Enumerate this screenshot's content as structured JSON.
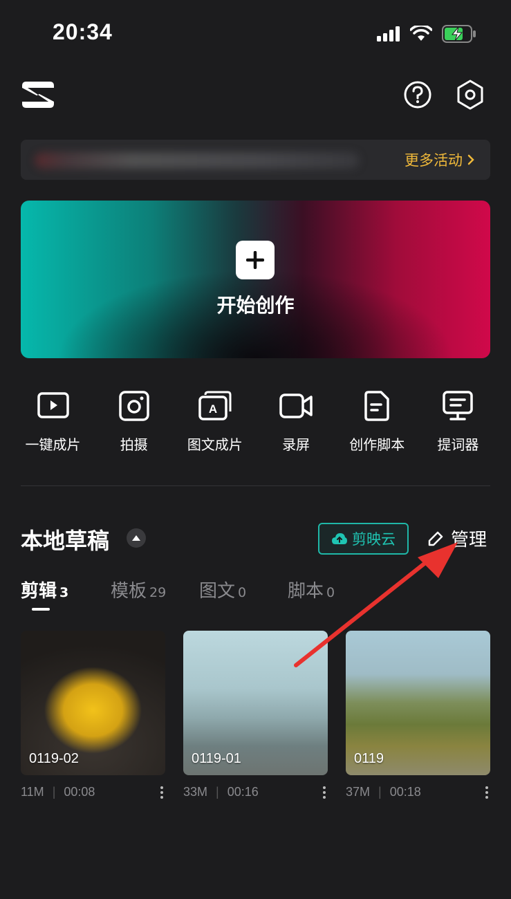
{
  "status_bar": {
    "time": "20:34"
  },
  "banner": {
    "more_label": "更多活动"
  },
  "create": {
    "label": "开始创作"
  },
  "tools": [
    {
      "label": "一键成片",
      "icon": "play-box-icon"
    },
    {
      "label": "拍摄",
      "icon": "camera-icon"
    },
    {
      "label": "图文成片",
      "icon": "text-image-icon"
    },
    {
      "label": "录屏",
      "icon": "video-camera-icon"
    },
    {
      "label": "创作脚本",
      "icon": "script-icon"
    },
    {
      "label": "提词器",
      "icon": "teleprompter-icon"
    }
  ],
  "drafts": {
    "title": "本地草稿",
    "cloud_label": "剪映云",
    "manage_label": "管理",
    "tabs": [
      {
        "label": "剪辑",
        "count": "3",
        "active": true
      },
      {
        "label": "模板",
        "count": "29",
        "active": false
      },
      {
        "label": "图文",
        "count": "0",
        "active": false
      },
      {
        "label": "脚本",
        "count": "0",
        "active": false
      }
    ],
    "items": [
      {
        "name": "0119-02",
        "size": "11M",
        "duration": "00:08"
      },
      {
        "name": "0119-01",
        "size": "33M",
        "duration": "00:16"
      },
      {
        "name": "0119",
        "size": "37M",
        "duration": "00:18"
      }
    ]
  },
  "colors": {
    "background": "#1c1c1e",
    "accent_teal": "#1fb8a8",
    "banner_link": "#f0b93a",
    "annotation_arrow": "#e8322e"
  }
}
